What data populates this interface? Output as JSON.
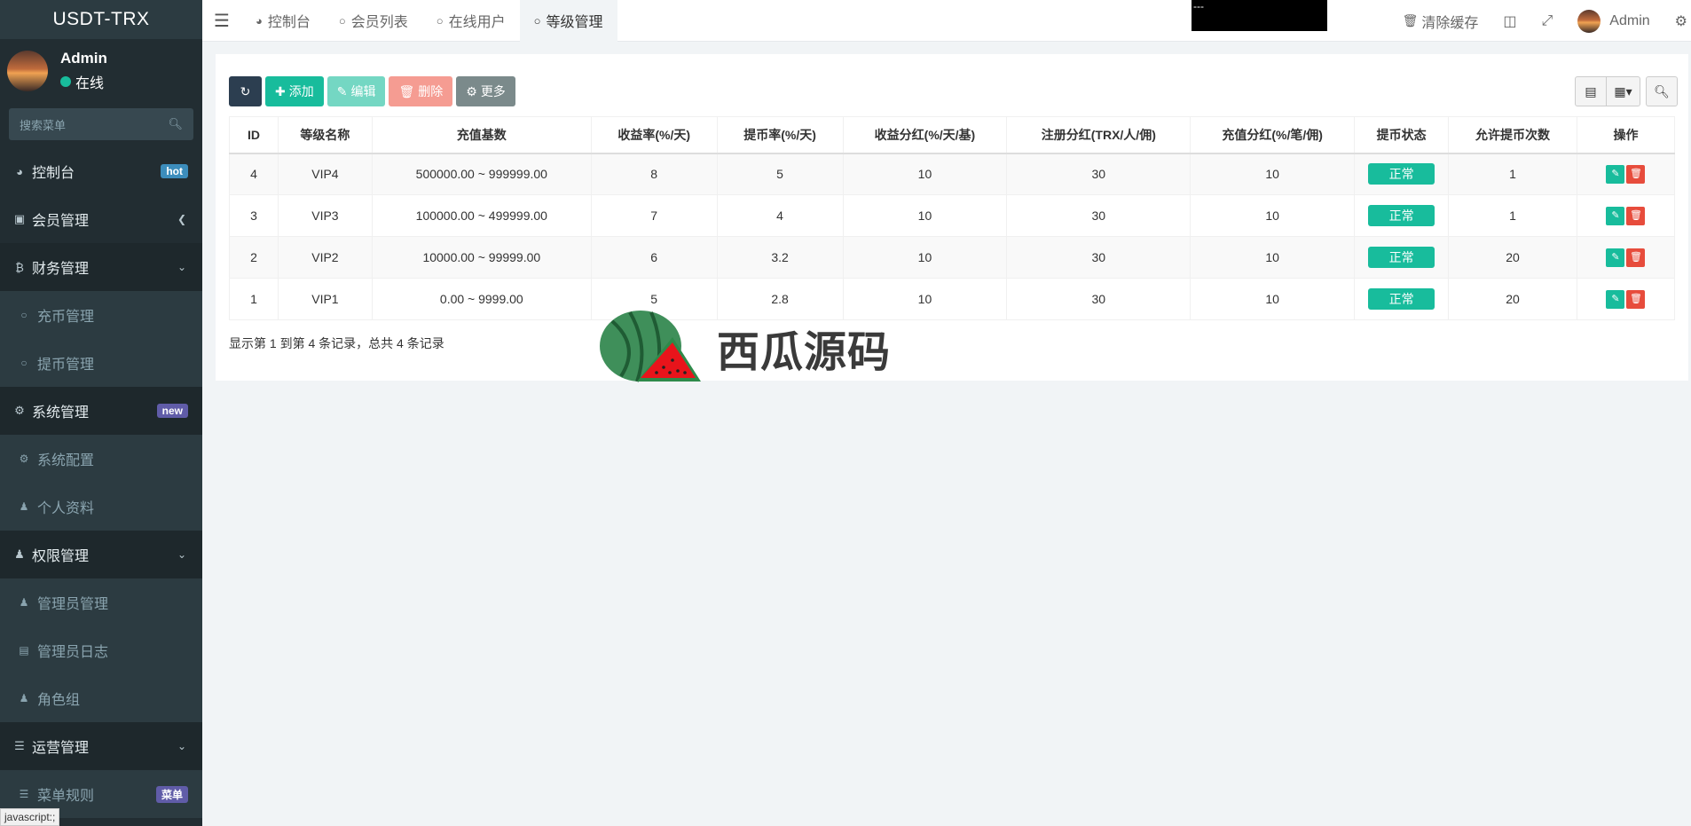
{
  "app": {
    "brand": "USDT-TRX"
  },
  "user": {
    "name": "Admin",
    "status": "在线"
  },
  "sidebar": {
    "search_placeholder": "搜索菜单",
    "items": [
      {
        "label": "控制台",
        "icon": "dashboard-icon",
        "badge": "hot"
      },
      {
        "label": "会员管理",
        "icon": "user-card-icon",
        "chevron": "left"
      },
      {
        "label": "财务管理",
        "icon": "bitcoin-icon",
        "chevron": "down",
        "children": [
          {
            "label": "充币管理",
            "icon": "circle-icon"
          },
          {
            "label": "提币管理",
            "icon": "circle-icon"
          }
        ]
      },
      {
        "label": "系统管理",
        "icon": "cogs-icon",
        "badge": "new",
        "children": [
          {
            "label": "系统配置",
            "icon": "gear-icon"
          },
          {
            "label": "个人资料",
            "icon": "user-icon"
          }
        ]
      },
      {
        "label": "权限管理",
        "icon": "group-icon",
        "chevron": "down",
        "children": [
          {
            "label": "管理员管理",
            "icon": "user-icon"
          },
          {
            "label": "管理员日志",
            "icon": "list-alt-icon"
          },
          {
            "label": "角色组",
            "icon": "group-icon"
          }
        ]
      },
      {
        "label": "运营管理",
        "icon": "list-icon",
        "chevron": "down",
        "children": [
          {
            "label": "菜单规则",
            "icon": "bars-icon",
            "badge": "菜单"
          }
        ]
      }
    ],
    "status_tip": "javascript:;"
  },
  "topbar": {
    "tabs": [
      {
        "label": "控制台",
        "icon": "dashboard-icon",
        "active": false
      },
      {
        "label": "会员列表",
        "icon": "circle-icon",
        "active": false
      },
      {
        "label": "在线用户",
        "icon": "circle-icon",
        "active": false
      },
      {
        "label": "等级管理",
        "icon": "circle-icon",
        "active": true
      }
    ],
    "black_box_text": "---",
    "clear_cache": "清除缓存",
    "admin": "Admin"
  },
  "toolbar": {
    "add": "添加",
    "edit": "编辑",
    "delete": "删除",
    "more": "更多"
  },
  "table": {
    "columns": [
      "ID",
      "等级名称",
      "充值基数",
      "收益率(%/天)",
      "提币率(%/天)",
      "收益分红(%/天/基)",
      "注册分红(TRX/人/佣)",
      "充值分红(%/笔/佣)",
      "提币状态",
      "允许提币次数",
      "操作"
    ],
    "rows": [
      {
        "id": "4",
        "name": "VIP4",
        "base": "500000.00 ~ 999999.00",
        "yield": "8",
        "withdraw_rate": "5",
        "yield_bonus": "10",
        "reg_bonus": "30",
        "recharge_bonus": "10",
        "status": "正常",
        "withdraw_times": "1"
      },
      {
        "id": "3",
        "name": "VIP3",
        "base": "100000.00 ~ 499999.00",
        "yield": "7",
        "withdraw_rate": "4",
        "yield_bonus": "10",
        "reg_bonus": "30",
        "recharge_bonus": "10",
        "status": "正常",
        "withdraw_times": "1"
      },
      {
        "id": "2",
        "name": "VIP2",
        "base": "10000.00 ~ 99999.00",
        "yield": "6",
        "withdraw_rate": "3.2",
        "yield_bonus": "10",
        "reg_bonus": "30",
        "recharge_bonus": "10",
        "status": "正常",
        "withdraw_times": "20"
      },
      {
        "id": "1",
        "name": "VIP1",
        "base": "0.00 ~ 9999.00",
        "yield": "5",
        "withdraw_rate": "2.8",
        "yield_bonus": "10",
        "reg_bonus": "30",
        "recharge_bonus": "10",
        "status": "正常",
        "withdraw_times": "20"
      }
    ],
    "pagination_info": "显示第 1 到第 4 条记录，总共 4 条记录"
  },
  "watermark": {
    "text": "西瓜源码"
  },
  "colors": {
    "sidebar_bg": "#222d32",
    "success": "#18bc9c",
    "danger": "#e74c3c",
    "primary_dark": "#2c3e50"
  }
}
